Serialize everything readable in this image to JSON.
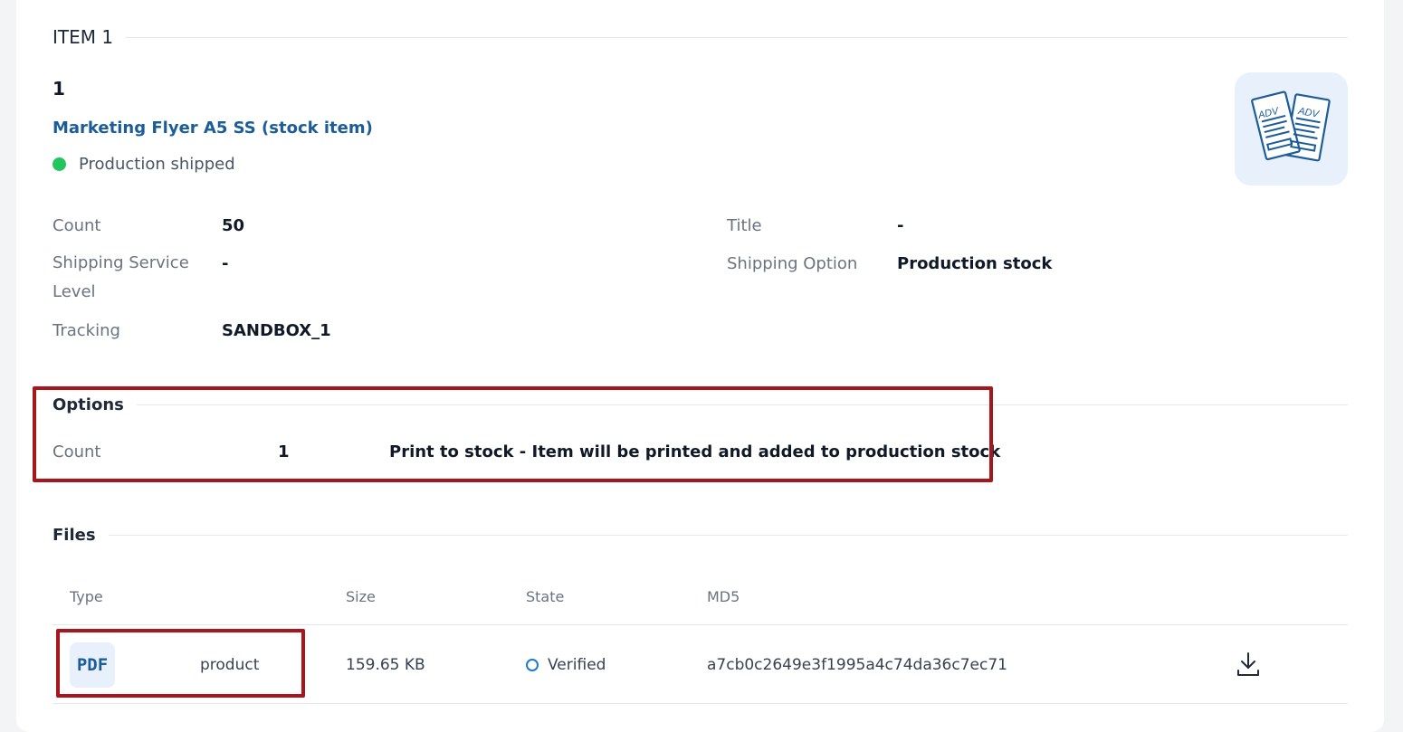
{
  "item": {
    "header": "ITEM 1",
    "number": "1",
    "product_name": "Marketing Flyer A5 SS (stock item)",
    "status": "Production shipped",
    "status_color": "#22c55e",
    "thumbnail_icon": "adv-flyer-icon",
    "thumbnail_text_a": "ADV",
    "thumbnail_text_b": "ADV"
  },
  "details": {
    "left": [
      {
        "label": "Count",
        "value": "50"
      },
      {
        "label": "Shipping Service Level",
        "value": "-"
      },
      {
        "label": "Tracking",
        "value": "SANDBOX_1"
      }
    ],
    "right": [
      {
        "label": "Title",
        "value": "-"
      },
      {
        "label": "Shipping Option",
        "value": "Production stock"
      }
    ]
  },
  "options": {
    "title": "Options",
    "rows": [
      {
        "label": "Count",
        "value": "1",
        "description": "Print to stock - Item will be printed and added to production stock"
      }
    ]
  },
  "files": {
    "title": "Files",
    "columns": [
      "Type",
      "Size",
      "State",
      "MD5"
    ],
    "rows": [
      {
        "type_badge": "PDF",
        "type_name": "product",
        "size": "159.65 KB",
        "state": "Verified",
        "md5": "a7cb0c2649e3f1995a4c74da36c7ec71",
        "action_icon": "download-icon"
      }
    ]
  },
  "colors": {
    "link": "#1c5d99",
    "highlight": "#a8161b",
    "verified": "#1c7ad1"
  }
}
